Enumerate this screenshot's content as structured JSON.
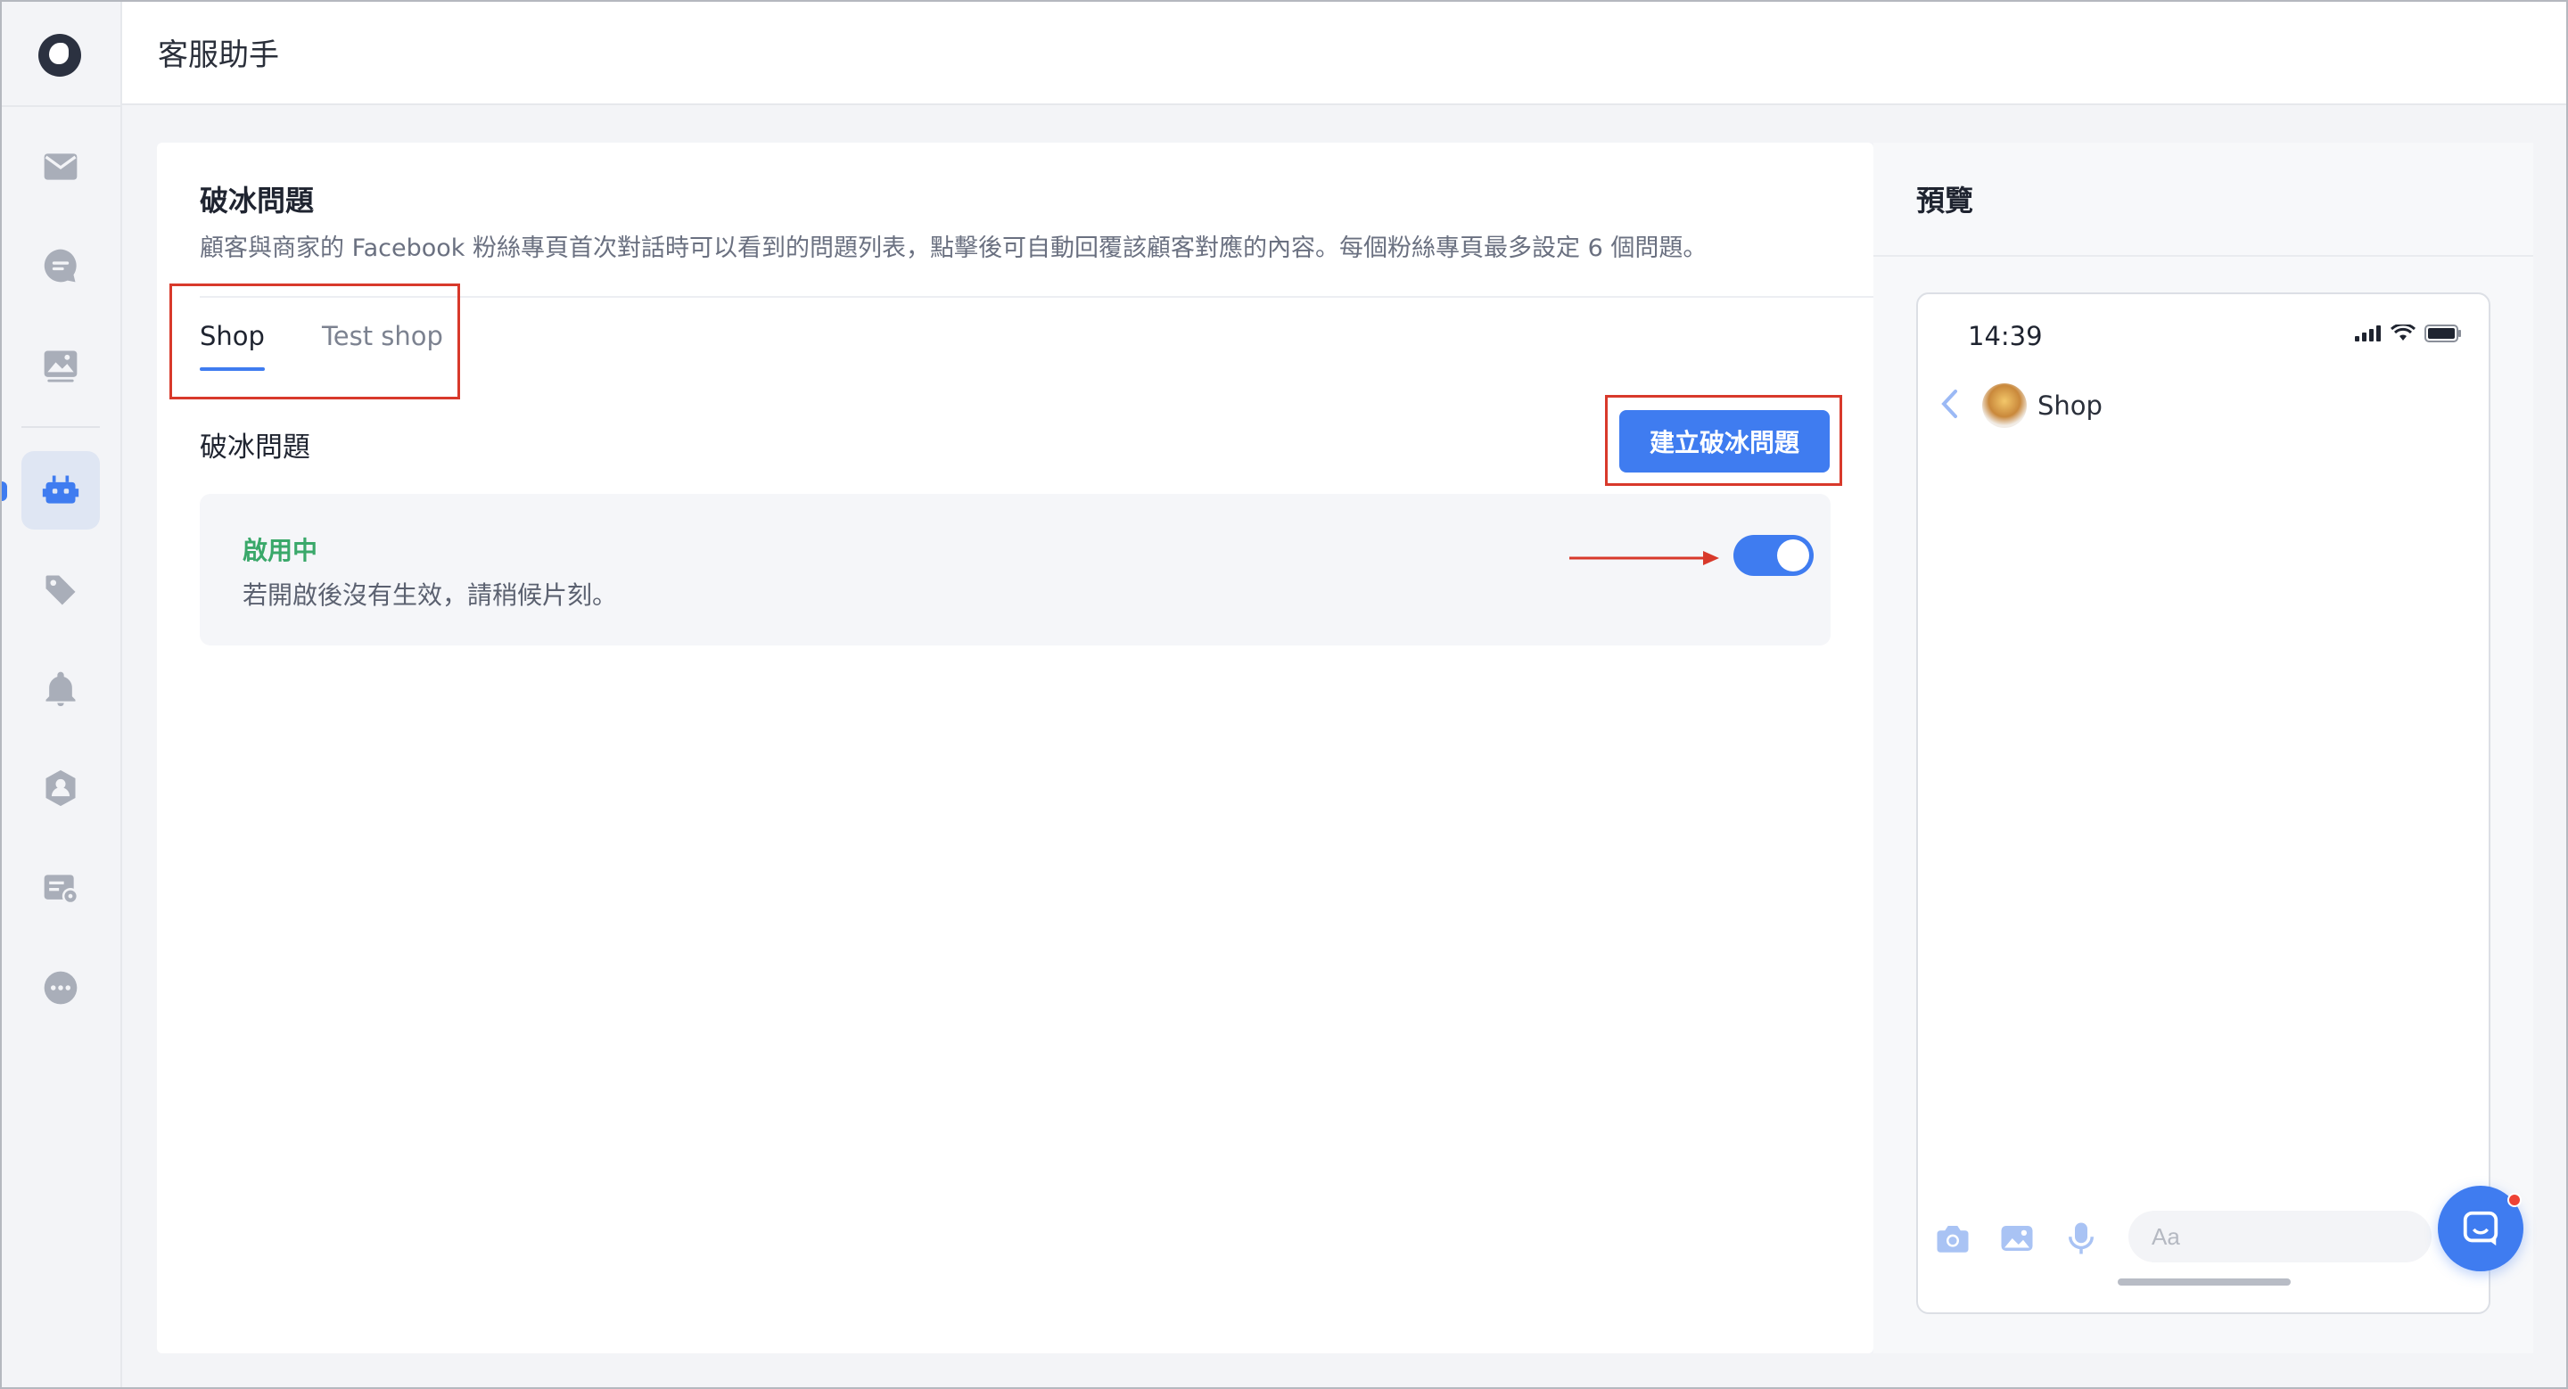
{
  "header": {
    "title": "客服助手"
  },
  "sidebar": {
    "items": [
      {
        "icon": "mail-icon"
      },
      {
        "icon": "chat-icon"
      },
      {
        "icon": "image-icon"
      },
      {
        "icon": "bot-icon",
        "active": true
      },
      {
        "icon": "tag-icon"
      },
      {
        "icon": "bell-icon"
      },
      {
        "icon": "user-shield-icon"
      },
      {
        "icon": "card-settings-icon"
      },
      {
        "icon": "more-icon"
      }
    ]
  },
  "main": {
    "title": "破冰問題",
    "description": "顧客與商家的 Facebook 粉絲專頁首次對話時可以看到的問題列表，點擊後可自動回覆該顧客對應的內容。每個粉絲專頁最多設定 6 個問題。",
    "tabs": [
      {
        "label": "Shop",
        "active": true
      },
      {
        "label": "Test shop",
        "active": false
      }
    ],
    "section_title": "破冰問題",
    "create_button": "建立破冰問題",
    "status": {
      "label": "啟用中",
      "note": "若開啟後沒有生效，請稍候片刻。",
      "enabled": true
    }
  },
  "preview": {
    "title": "預覽",
    "phone": {
      "time": "14:39",
      "page_name": "Shop",
      "input_placeholder": "Aa"
    }
  },
  "colors": {
    "accent": "#3f7cf0",
    "highlight": "#d8392b",
    "status_green": "#3aa86a"
  }
}
